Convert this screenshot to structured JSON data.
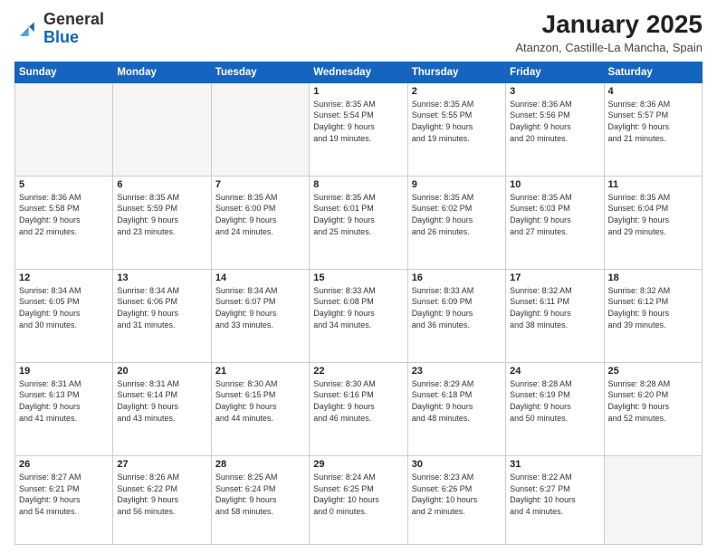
{
  "logo": {
    "general": "General",
    "blue": "Blue"
  },
  "header": {
    "title": "January 2025",
    "subtitle": "Atanzon, Castille-La Mancha, Spain"
  },
  "weekdays": [
    "Sunday",
    "Monday",
    "Tuesday",
    "Wednesday",
    "Thursday",
    "Friday",
    "Saturday"
  ],
  "weeks": [
    [
      {
        "day": "",
        "info": ""
      },
      {
        "day": "",
        "info": ""
      },
      {
        "day": "",
        "info": ""
      },
      {
        "day": "1",
        "info": "Sunrise: 8:35 AM\nSunset: 5:54 PM\nDaylight: 9 hours\nand 19 minutes."
      },
      {
        "day": "2",
        "info": "Sunrise: 8:35 AM\nSunset: 5:55 PM\nDaylight: 9 hours\nand 19 minutes."
      },
      {
        "day": "3",
        "info": "Sunrise: 8:36 AM\nSunset: 5:56 PM\nDaylight: 9 hours\nand 20 minutes."
      },
      {
        "day": "4",
        "info": "Sunrise: 8:36 AM\nSunset: 5:57 PM\nDaylight: 9 hours\nand 21 minutes."
      }
    ],
    [
      {
        "day": "5",
        "info": "Sunrise: 8:36 AM\nSunset: 5:58 PM\nDaylight: 9 hours\nand 22 minutes."
      },
      {
        "day": "6",
        "info": "Sunrise: 8:35 AM\nSunset: 5:59 PM\nDaylight: 9 hours\nand 23 minutes."
      },
      {
        "day": "7",
        "info": "Sunrise: 8:35 AM\nSunset: 6:00 PM\nDaylight: 9 hours\nand 24 minutes."
      },
      {
        "day": "8",
        "info": "Sunrise: 8:35 AM\nSunset: 6:01 PM\nDaylight: 9 hours\nand 25 minutes."
      },
      {
        "day": "9",
        "info": "Sunrise: 8:35 AM\nSunset: 6:02 PM\nDaylight: 9 hours\nand 26 minutes."
      },
      {
        "day": "10",
        "info": "Sunrise: 8:35 AM\nSunset: 6:03 PM\nDaylight: 9 hours\nand 27 minutes."
      },
      {
        "day": "11",
        "info": "Sunrise: 8:35 AM\nSunset: 6:04 PM\nDaylight: 9 hours\nand 29 minutes."
      }
    ],
    [
      {
        "day": "12",
        "info": "Sunrise: 8:34 AM\nSunset: 6:05 PM\nDaylight: 9 hours\nand 30 minutes."
      },
      {
        "day": "13",
        "info": "Sunrise: 8:34 AM\nSunset: 6:06 PM\nDaylight: 9 hours\nand 31 minutes."
      },
      {
        "day": "14",
        "info": "Sunrise: 8:34 AM\nSunset: 6:07 PM\nDaylight: 9 hours\nand 33 minutes."
      },
      {
        "day": "15",
        "info": "Sunrise: 8:33 AM\nSunset: 6:08 PM\nDaylight: 9 hours\nand 34 minutes."
      },
      {
        "day": "16",
        "info": "Sunrise: 8:33 AM\nSunset: 6:09 PM\nDaylight: 9 hours\nand 36 minutes."
      },
      {
        "day": "17",
        "info": "Sunrise: 8:32 AM\nSunset: 6:11 PM\nDaylight: 9 hours\nand 38 minutes."
      },
      {
        "day": "18",
        "info": "Sunrise: 8:32 AM\nSunset: 6:12 PM\nDaylight: 9 hours\nand 39 minutes."
      }
    ],
    [
      {
        "day": "19",
        "info": "Sunrise: 8:31 AM\nSunset: 6:13 PM\nDaylight: 9 hours\nand 41 minutes."
      },
      {
        "day": "20",
        "info": "Sunrise: 8:31 AM\nSunset: 6:14 PM\nDaylight: 9 hours\nand 43 minutes."
      },
      {
        "day": "21",
        "info": "Sunrise: 8:30 AM\nSunset: 6:15 PM\nDaylight: 9 hours\nand 44 minutes."
      },
      {
        "day": "22",
        "info": "Sunrise: 8:30 AM\nSunset: 6:16 PM\nDaylight: 9 hours\nand 46 minutes."
      },
      {
        "day": "23",
        "info": "Sunrise: 8:29 AM\nSunset: 6:18 PM\nDaylight: 9 hours\nand 48 minutes."
      },
      {
        "day": "24",
        "info": "Sunrise: 8:28 AM\nSunset: 6:19 PM\nDaylight: 9 hours\nand 50 minutes."
      },
      {
        "day": "25",
        "info": "Sunrise: 8:28 AM\nSunset: 6:20 PM\nDaylight: 9 hours\nand 52 minutes."
      }
    ],
    [
      {
        "day": "26",
        "info": "Sunrise: 8:27 AM\nSunset: 6:21 PM\nDaylight: 9 hours\nand 54 minutes."
      },
      {
        "day": "27",
        "info": "Sunrise: 8:26 AM\nSunset: 6:22 PM\nDaylight: 9 hours\nand 56 minutes."
      },
      {
        "day": "28",
        "info": "Sunrise: 8:25 AM\nSunset: 6:24 PM\nDaylight: 9 hours\nand 58 minutes."
      },
      {
        "day": "29",
        "info": "Sunrise: 8:24 AM\nSunset: 6:25 PM\nDaylight: 10 hours\nand 0 minutes."
      },
      {
        "day": "30",
        "info": "Sunrise: 8:23 AM\nSunset: 6:26 PM\nDaylight: 10 hours\nand 2 minutes."
      },
      {
        "day": "31",
        "info": "Sunrise: 8:22 AM\nSunset: 6:27 PM\nDaylight: 10 hours\nand 4 minutes."
      },
      {
        "day": "",
        "info": ""
      }
    ]
  ]
}
